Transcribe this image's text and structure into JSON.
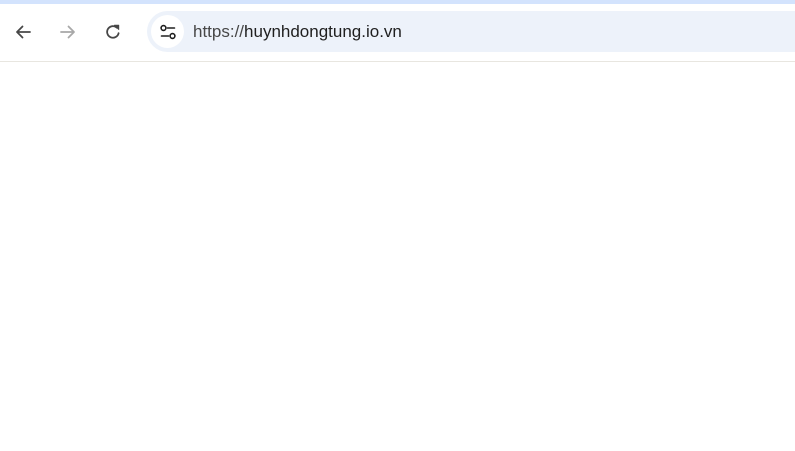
{
  "browser": {
    "nav": {
      "back_icon": "arrow-left-icon",
      "forward_icon": "arrow-right-icon",
      "reload_icon": "reload-icon"
    },
    "omnibox": {
      "site_info_icon": "tune-icon",
      "url_scheme": "https://",
      "url_host": "huynhdongtung.io.vn"
    }
  },
  "colors": {
    "top_strip": "#d3e3fd",
    "omnibox_bg": "#edf2fa",
    "icon_active": "#474747",
    "icon_disabled": "#a8a8a8"
  }
}
